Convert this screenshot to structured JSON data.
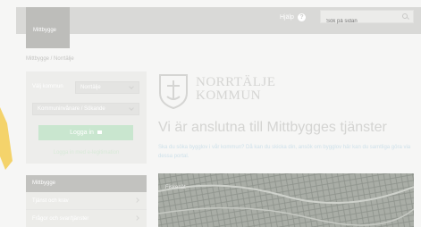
{
  "header": {
    "logo_text": "Mittbygge",
    "help_label": "Hjälp",
    "search_placeholder": "Sök på sidan"
  },
  "breadcrumb": "Mittbygge / Norrtälje",
  "login": {
    "municipality_label": "Välj kommun",
    "municipality_value": "Norrtälje",
    "role_value": "Kommuninvånare / Sökande",
    "button_label": "Logga in",
    "signup_link": "Logga in med e-legitimation"
  },
  "menu": {
    "header": "Mittbygge",
    "items": [
      {
        "label": "Tjänst och krav"
      },
      {
        "label": "Frågor och svar/tjänster"
      }
    ]
  },
  "brand": {
    "line1": "NORRTÄLJE",
    "line2": "KOMMUN"
  },
  "main": {
    "headline": "Vi är anslutna till Mittbygges tjänster",
    "intro": "Ska du söka bygglov i vår kommun? Då kan du skicka din, ansök om bygglov här kan du samtliga göra via dessa portal.",
    "hero_label": "Fiskenät"
  },
  "colors": {
    "topbar": "#d9d9d7",
    "accent_green": "#c9e6cf",
    "ribbon": "#f4d36b"
  }
}
